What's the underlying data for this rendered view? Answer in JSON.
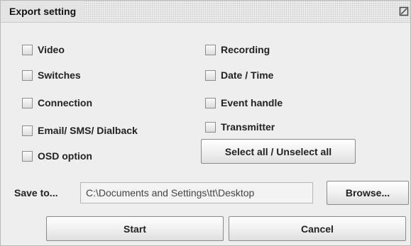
{
  "window": {
    "title": "Export setting"
  },
  "options": {
    "video": "Video",
    "switches": "Switches",
    "connection": "Connection",
    "email": "Email/ SMS/ Dialback",
    "osd": "OSD option",
    "recording": "Recording",
    "datetime": "Date / Time",
    "event": "Event handle",
    "transmitter": "Transmitter"
  },
  "select_all_label": "Select all / Unselect all",
  "save": {
    "label": "Save to...",
    "path": "C:\\Documents and Settings\\tt\\Desktop",
    "browse_label": "Browse..."
  },
  "actions": {
    "start": "Start",
    "cancel": "Cancel"
  }
}
